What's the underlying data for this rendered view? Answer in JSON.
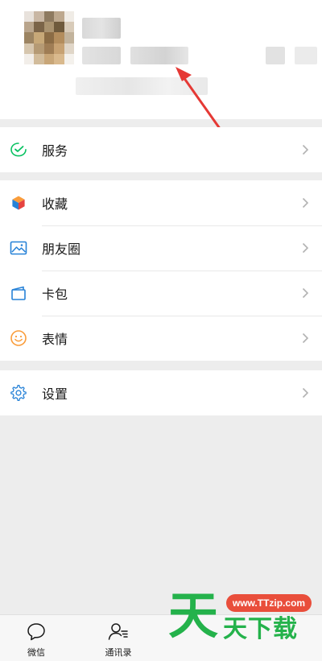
{
  "annotation": {
    "arrow_color": "#e53935",
    "purpose": "points-to-profile-id"
  },
  "menu": {
    "group1": [
      {
        "id": "services",
        "label": "服务",
        "icon": "wechat-pay-check-icon"
      }
    ],
    "group2": [
      {
        "id": "favorites",
        "label": "收藏",
        "icon": "favorites-cube-icon"
      },
      {
        "id": "moments",
        "label": "朋友圈",
        "icon": "moments-picture-icon"
      },
      {
        "id": "cards",
        "label": "卡包",
        "icon": "card-wallet-icon"
      },
      {
        "id": "stickers",
        "label": "表情",
        "icon": "smiley-icon"
      }
    ],
    "group3": [
      {
        "id": "settings",
        "label": "设置",
        "icon": "gear-icon"
      }
    ]
  },
  "tabbar": {
    "tabs": [
      {
        "id": "chats",
        "label": "微信",
        "icon": "chat-bubble-icon"
      },
      {
        "id": "contacts",
        "label": "通讯录",
        "icon": "contacts-icon"
      }
    ]
  },
  "watermark": {
    "url": "www.TTzip.com",
    "big_char": "天",
    "text": "天下载"
  },
  "colors": {
    "accent_green": "#07c160",
    "watermark_green": "#24b24b",
    "watermark_red": "#e94e3b",
    "background": "#ededed"
  }
}
